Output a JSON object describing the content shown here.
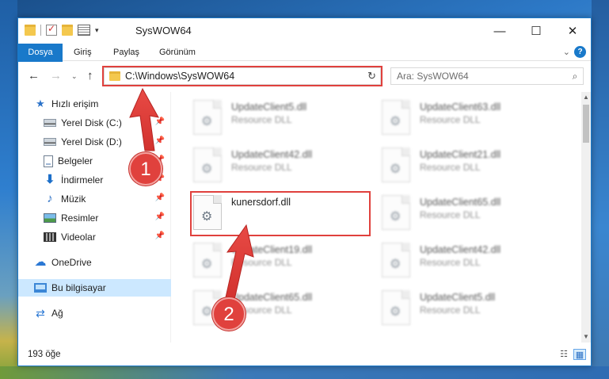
{
  "window": {
    "title": "SysWOW64",
    "minimize_glyph": "—",
    "maximize_glyph": "☐",
    "close_glyph": "✕"
  },
  "quick_access_toolbar": {
    "icons": [
      "folder-icon",
      "properties-check-icon",
      "new-folder-icon",
      "properties-icon"
    ],
    "dropdown_glyph": "▾"
  },
  "ribbon": {
    "tabs": [
      {
        "label": "Dosya",
        "active": true
      },
      {
        "label": "Giriş"
      },
      {
        "label": "Paylaş"
      },
      {
        "label": "Görünüm"
      }
    ],
    "expand_glyph": "⌄",
    "help_glyph": "?",
    "file_tab_color": "#1979ca"
  },
  "navigation": {
    "back_glyph": "←",
    "forward_glyph": "→",
    "recent_glyph": "⌄",
    "up_glyph": "↑",
    "address": "C:\\Windows\\SysWOW64",
    "address_dropdown_glyph": "⌄",
    "refresh_glyph": "↻",
    "search_placeholder": "Ara: SysWOW64",
    "search_glyph": "⌕"
  },
  "sidebar": {
    "items": [
      {
        "label": "Hızlı erişim",
        "icon": "star-icon",
        "pinned": false
      },
      {
        "label": "Yerel Disk (C:)",
        "icon": "disk-icon",
        "pinned": true
      },
      {
        "label": "Yerel Disk (D:)",
        "icon": "disk-icon",
        "pinned": true
      },
      {
        "label": "Belgeler",
        "icon": "documents-icon",
        "pinned": true
      },
      {
        "label": "İndirmeler",
        "icon": "download-icon",
        "pinned": true
      },
      {
        "label": "Müzik",
        "icon": "music-icon",
        "pinned": true
      },
      {
        "label": "Resimler",
        "icon": "pictures-icon",
        "pinned": true
      },
      {
        "label": "Videolar",
        "icon": "videos-icon",
        "pinned": true
      },
      {
        "label": "OneDrive",
        "icon": "cloud-icon",
        "pinned": false
      },
      {
        "label": "Bu bilgisayar",
        "icon": "computer-icon",
        "pinned": false,
        "selected": true
      },
      {
        "label": "Ağ",
        "icon": "network-icon",
        "pinned": false
      }
    ],
    "pin_glyph": "📌",
    "selected_color": "#cce8ff"
  },
  "files": {
    "left_column": [
      {
        "name": "UpdateClient5.dll",
        "type": "Resource DLL",
        "blurred": true
      },
      {
        "name": "UpdateClient42.dll",
        "type": "Resource DLL",
        "blurred": true
      },
      {
        "name": "kunersdorf.dll",
        "type": "",
        "blurred": false
      },
      {
        "name": "UpdateClient19.dll",
        "type": "Resource DLL",
        "blurred": true
      },
      {
        "name": "UpdateClient65.dll",
        "type": "Resource DLL",
        "blurred": true
      }
    ],
    "right_column": [
      {
        "name": "UpdateClient63.dll",
        "type": "Resource DLL",
        "blurred": true
      },
      {
        "name": "UpdateClient21.dll",
        "type": "Resource DLL",
        "blurred": true
      },
      {
        "name": "UpdateClient65.dll",
        "type": "Resource DLL",
        "blurred": true
      },
      {
        "name": "UpdateClient42.dll",
        "type": "Resource DLL",
        "blurred": true
      },
      {
        "name": "UpdateClient5.dll",
        "type": "Resource DLL",
        "blurred": true
      }
    ],
    "file_icon_glyph": "⚙"
  },
  "scrollbar": {
    "up_glyph": "▲",
    "down_glyph": "▼"
  },
  "status": {
    "item_count": "193 öğe",
    "details_view_glyph": "☷",
    "large_icons_glyph": "▦"
  },
  "annotations": {
    "step1": "1",
    "step2": "2",
    "highlight_color": "#e0413d"
  }
}
